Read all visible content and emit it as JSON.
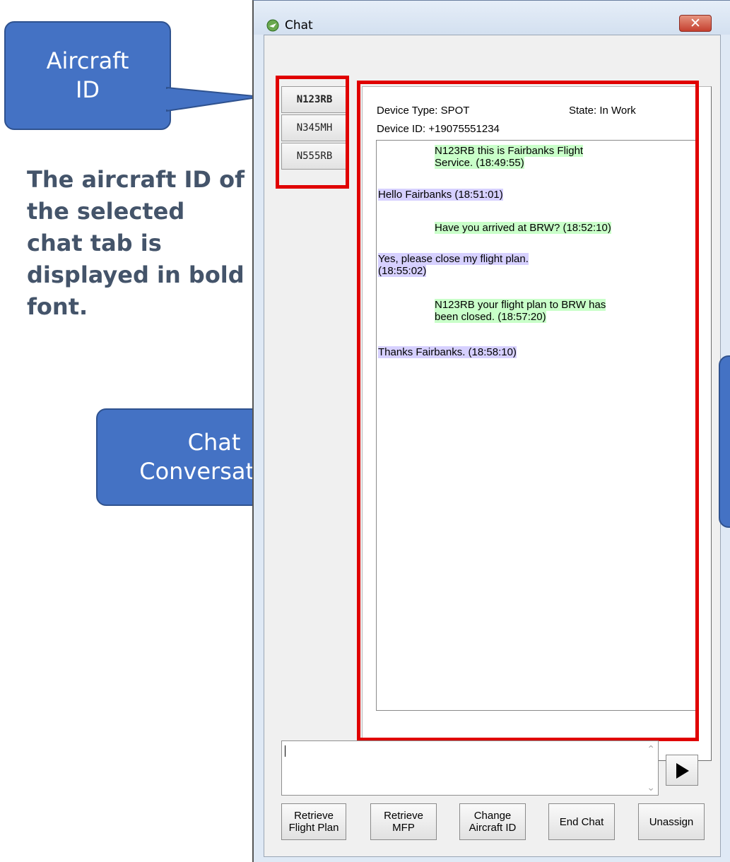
{
  "callouts": {
    "aircraft_id": "Aircraft\nID",
    "chat_conversation": "Chat\nConversation"
  },
  "note": "The aircraft ID of the selected chat tab is displayed in bold font.",
  "window": {
    "title": "Chat",
    "close_glyph": "✕"
  },
  "tabs": [
    {
      "label": "N123RB",
      "selected": true
    },
    {
      "label": "N345MH",
      "selected": false
    },
    {
      "label": "N555RB",
      "selected": false
    }
  ],
  "device": {
    "type": "Device Type: SPOT",
    "id": "Device ID: +19075551234",
    "state": "State: In Work"
  },
  "messages": [
    {
      "text": "N123RB this is Fairbanks Flight\nService. (18:49:55)",
      "from": "service"
    },
    {
      "text": "Hello Fairbanks (18:51:01)",
      "from": "pilot"
    },
    {
      "text": "Have you arrived at BRW? (18:52:10)",
      "from": "service"
    },
    {
      "text": "Yes, please close my flight plan.\n(18:55:02)",
      "from": "pilot"
    },
    {
      "text": "N123RB your flight plan to BRW has\nbeen closed. (18:57:20)",
      "from": "service"
    },
    {
      "text": "Thanks Fairbanks. (18:58:10)",
      "from": "pilot"
    }
  ],
  "input": {
    "value": ""
  },
  "buttons": {
    "retrieve_flight_plan": "Retrieve\nFlight Plan",
    "retrieve_mfp": "Retrieve\nMFP",
    "change_aircraft_id": "Change\nAircraft ID",
    "end_chat": "End Chat",
    "unassign": "Unassign"
  },
  "colors": {
    "callout": "#4472c4",
    "service_msg_bg": "#c9ffc9",
    "pilot_msg_bg": "#d6d0ff",
    "highlight_box": "#e00000"
  },
  "icons": {
    "send": "send-arrow-icon",
    "title": "chat-app-icon"
  }
}
